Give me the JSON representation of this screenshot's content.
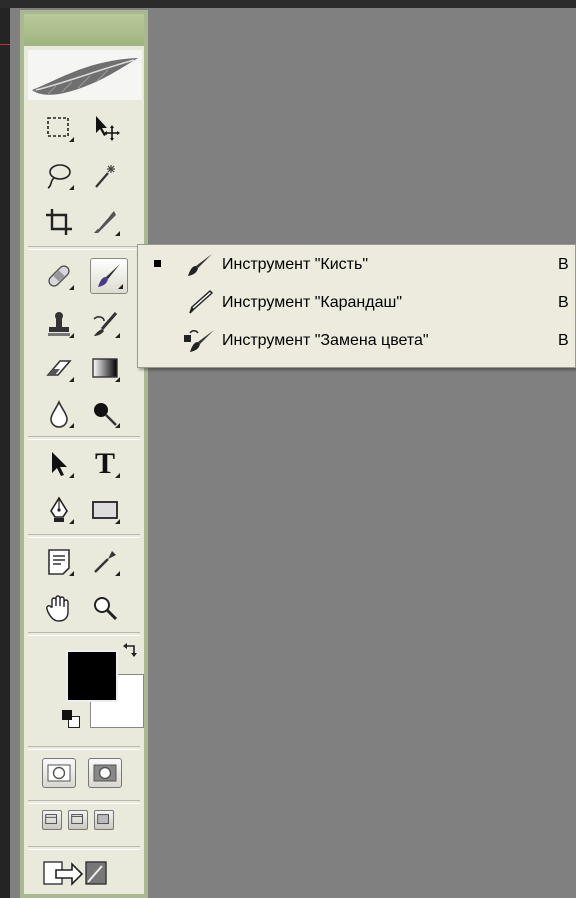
{
  "toolbox": {
    "tools": [
      {
        "name": "rectangular-marquee-tool",
        "icon": "marquee-icon"
      },
      {
        "name": "move-tool",
        "icon": "move-icon"
      },
      {
        "name": "lasso-tool",
        "icon": "lasso-icon"
      },
      {
        "name": "magic-wand-tool",
        "icon": "magic-wand-icon"
      },
      {
        "name": "crop-tool",
        "icon": "crop-icon"
      },
      {
        "name": "slice-tool",
        "icon": "slice-icon"
      },
      {
        "name": "healing-brush-tool",
        "icon": "bandage-icon"
      },
      {
        "name": "brush-tool",
        "icon": "brush-icon",
        "active": true
      },
      {
        "name": "clone-stamp-tool",
        "icon": "stamp-icon"
      },
      {
        "name": "history-brush-tool",
        "icon": "history-brush-icon"
      },
      {
        "name": "eraser-tool",
        "icon": "eraser-icon"
      },
      {
        "name": "gradient-tool",
        "icon": "gradient-icon"
      },
      {
        "name": "blur-tool",
        "icon": "drop-icon"
      },
      {
        "name": "dodge-tool",
        "icon": "dodge-icon"
      },
      {
        "name": "path-selection-tool",
        "icon": "arrow-icon"
      },
      {
        "name": "type-tool",
        "icon": "type-icon"
      },
      {
        "name": "pen-tool",
        "icon": "pen-icon"
      },
      {
        "name": "shape-tool",
        "icon": "rectangle-shape-icon"
      },
      {
        "name": "notes-tool",
        "icon": "notes-icon"
      },
      {
        "name": "eyedropper-tool",
        "icon": "eyedropper-icon"
      },
      {
        "name": "hand-tool",
        "icon": "hand-icon"
      },
      {
        "name": "zoom-tool",
        "icon": "zoom-icon"
      }
    ],
    "type_tool_glyph": "T",
    "foreground_color": "#000000",
    "background_color": "#ffffff"
  },
  "flyout": {
    "items": [
      {
        "label": "Инструмент \"Кисть\"",
        "shortcut": "B",
        "selected": true,
        "icon": "brush-icon"
      },
      {
        "label": "Инструмент \"Карандаш\"",
        "shortcut": "B",
        "selected": false,
        "icon": "pencil-icon"
      },
      {
        "label": "Инструмент \"Замена цвета\"",
        "shortcut": "B",
        "selected": false,
        "icon": "color-replacement-icon"
      }
    ]
  },
  "colors": {
    "canvas": "#808080",
    "toolbox_border": "#a9b890",
    "toolbox_body": "#e9eadc",
    "menu_bg": "#ecebdd"
  }
}
